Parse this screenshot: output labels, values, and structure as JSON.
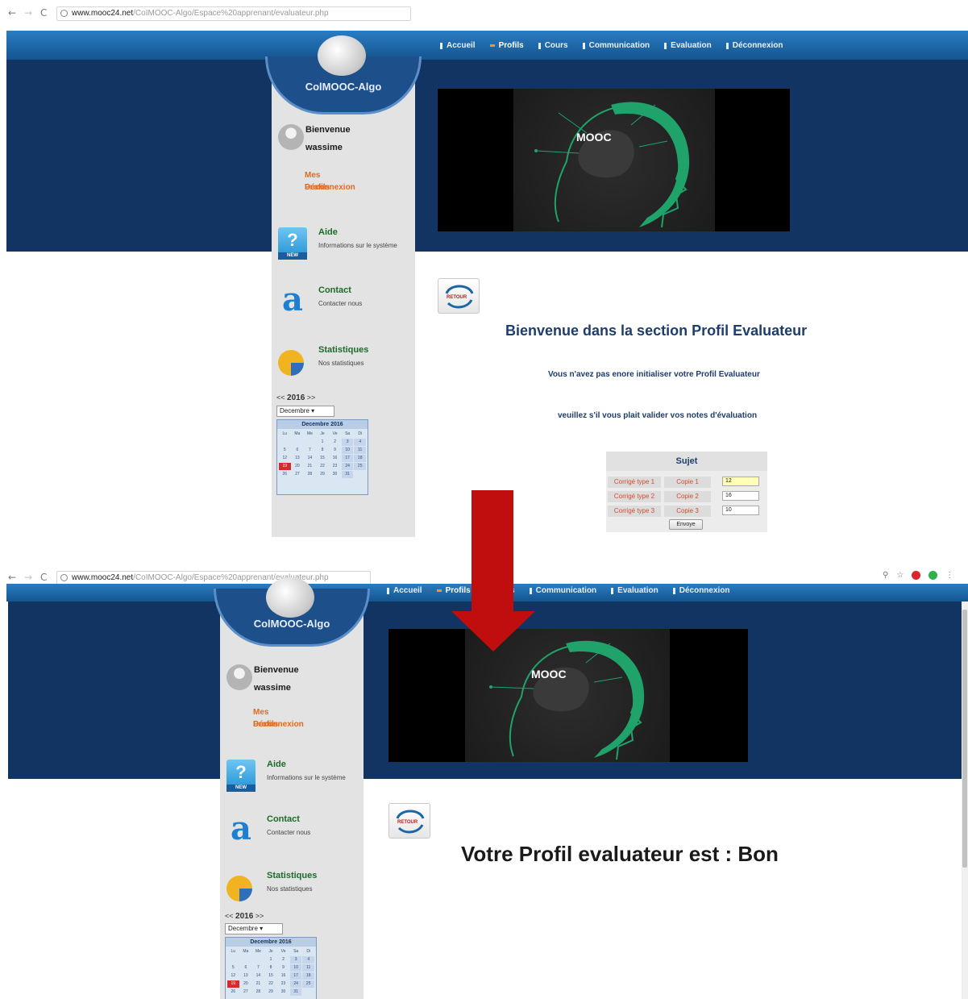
{
  "browser": {
    "url_host": "www.mooc24.net",
    "url_path_top": "/CoIMOOC-Algo/Espace%20apprenant/evaluateur.php",
    "url_path_bottom": "/CoIMOOC-Algo/Espace%20apprenant/evaluateur.php"
  },
  "menu": [
    {
      "label": "Accueil"
    },
    {
      "label": "Profils"
    },
    {
      "label": "Cours"
    },
    {
      "label": "Communication"
    },
    {
      "label": "Evaluation"
    },
    {
      "label": "Déconnexion"
    }
  ],
  "menu_active": "Profils",
  "logo": {
    "prefix": "Col",
    "strong": "MOOC-Algo"
  },
  "sidebar": {
    "welcome": "Bienvenue",
    "username": "wassime",
    "link_profiles": "Mes Profils",
    "link_logout": "Déconnexion",
    "help_title": "Aide",
    "help_desc": "Informations sur le système",
    "help_badge": "NEW",
    "contact_title": "Contact",
    "contact_desc": "Contacter nous",
    "stats_title_a": "Stat",
    "stats_title_b": "istiques",
    "stats_desc": "Nos statistiques",
    "year_prev": "<<",
    "year": "2016",
    "year_next": ">>",
    "month": "Decembre",
    "calendar_title": "Decembre 2016",
    "day_headers": [
      "Lu",
      "Ma",
      "Me",
      "Je",
      "Ve",
      "Sa",
      "Di",
      "S"
    ],
    "today": "19"
  },
  "video": {
    "label": "MOOC"
  },
  "retour_label": "RETOUR",
  "page1": {
    "heading": "Bienvenue dans la section Profil Evaluateur",
    "line1": "Vous n'avez pas enore initialiser votre Profil Evaluateur",
    "line2": "veuillez s'il vous plait valider vos notes d'évaluation",
    "form_title": "Sujet",
    "rows": [
      {
        "corrige": "Corrigé type 1",
        "copie": "Copie 1",
        "note": "12"
      },
      {
        "corrige": "Corrigé type 2",
        "copie": "Copie 2",
        "note": "16"
      },
      {
        "corrige": "Corrigé type 3",
        "copie": "Copie 3",
        "note": "10"
      }
    ],
    "submit": "Envoye"
  },
  "page2": {
    "result": "Votre Profil evaluateur est : Bon"
  },
  "colors": {
    "menu_blue": "#1d66a6",
    "band_navy": "#123462",
    "arrow_red": "#c00d0d",
    "link_orange": "#e06b1f",
    "mooc_green": "#1fa36a"
  }
}
